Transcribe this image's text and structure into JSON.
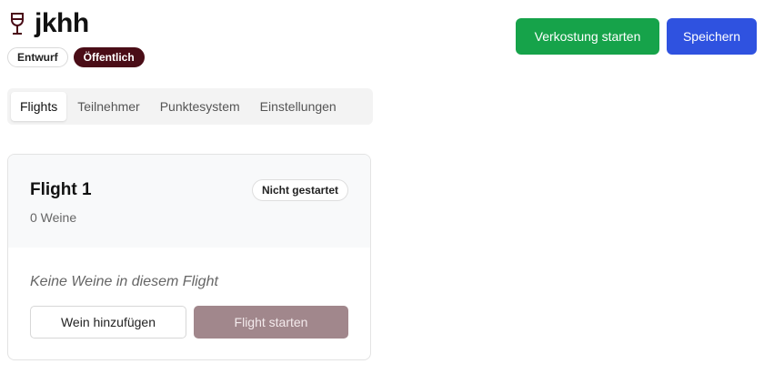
{
  "header": {
    "title": "jkhh",
    "icon": "wine-glass-icon",
    "badges": [
      "Entwurf",
      "Öffentlich"
    ]
  },
  "actions": {
    "start_label": "Verkostung starten",
    "save_label": "Speichern"
  },
  "tabs": [
    {
      "label": "Flights",
      "active": true
    },
    {
      "label": "Teilnehmer",
      "active": false
    },
    {
      "label": "Punktesystem",
      "active": false
    },
    {
      "label": "Einstellungen",
      "active": false
    }
  ],
  "flight": {
    "title": "Flight 1",
    "wine_count": "0 Weine",
    "status": "Nicht gestartet",
    "empty_text": "Keine Weine in diesem Flight",
    "add_wine_label": "Wein hinzufügen",
    "start_flight_label": "Flight starten"
  },
  "colors": {
    "start_green": "#16a34a",
    "save_blue": "#2f52e0",
    "wine_dark": "#4a0d17",
    "disabled_mauve": "#a1878c"
  }
}
